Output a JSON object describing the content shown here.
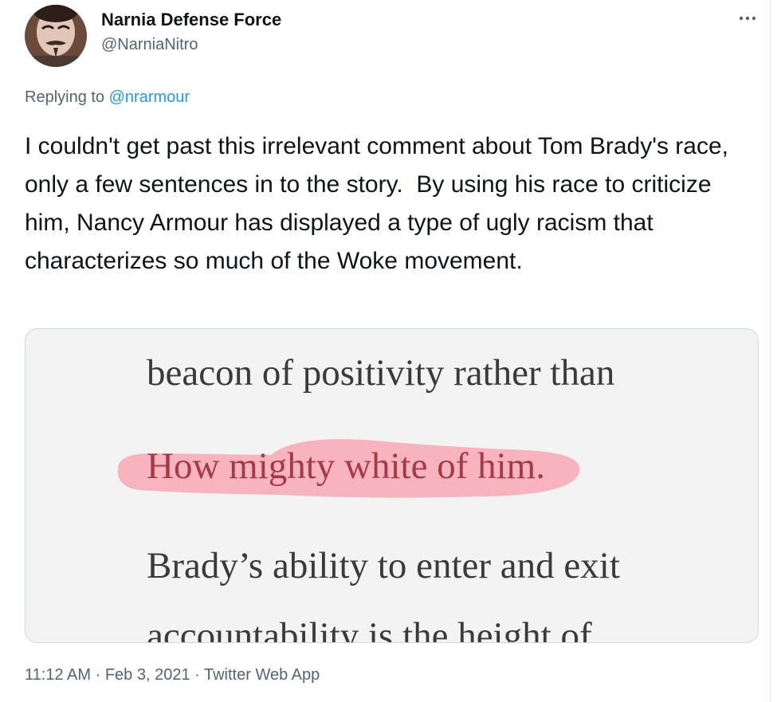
{
  "user": {
    "display_name": "Narnia Defense Force",
    "handle": "@NarniaNitro"
  },
  "reply": {
    "prefix": "Replying to ",
    "to": "@nrarmour"
  },
  "tweet": {
    "text": "I couldn't get past this irrelevant comment about Tom Brady's race, only a few sentences in to the story.  By using his race to criticize him, Nancy Armour has displayed a type of ugly racism that characterizes so much of the Woke movement."
  },
  "media": {
    "lines": [
      "beacon of positivity rather than",
      "How mighty white of him.",
      "Brady’s ability to enter and exit",
      "accountability is the height of"
    ],
    "highlight_color": "#f7a8b4"
  },
  "meta": {
    "time": "11:12 AM",
    "sep1": " · ",
    "date": "Feb 3, 2021",
    "sep2": " · ",
    "source": "Twitter Web App"
  },
  "colors": {
    "accent": "#1d9bf0",
    "secondary_text": "#536471",
    "primary_text": "#0f1419"
  }
}
